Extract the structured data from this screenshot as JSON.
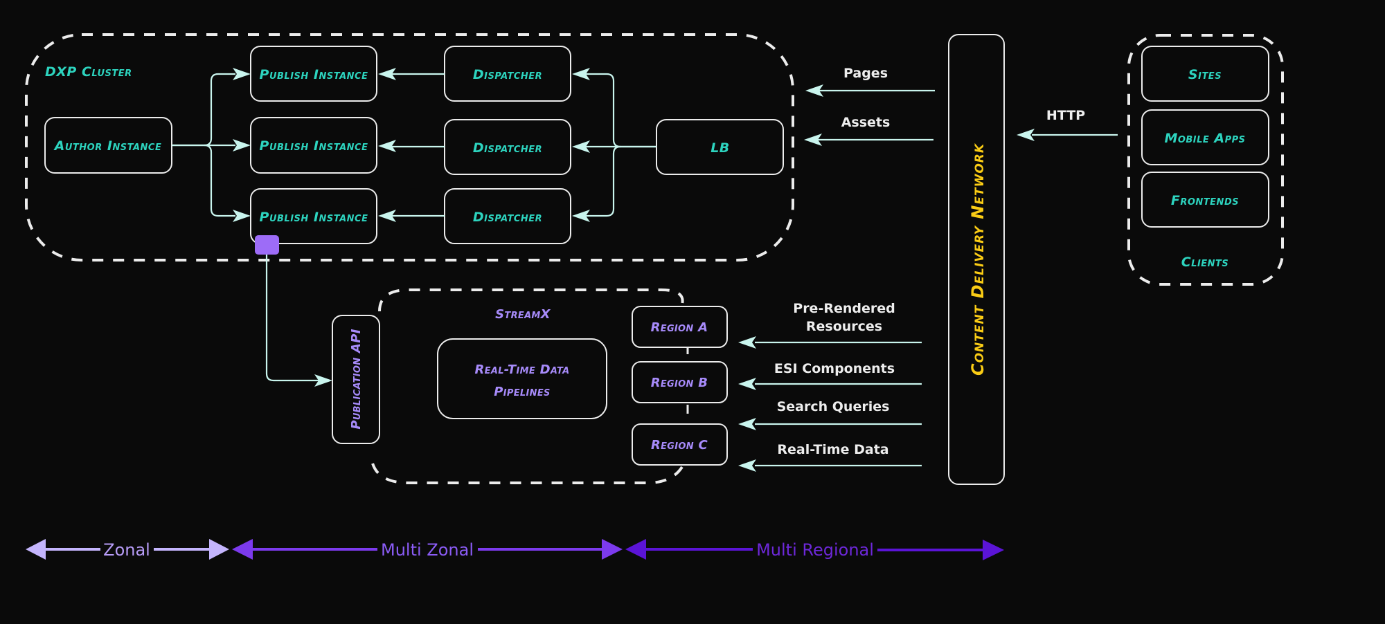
{
  "colors": {
    "background": "#0a0a0a",
    "box_stroke": "#ececec",
    "connector": "#c9f5ee",
    "teal_text": "#2dd4bf",
    "purple_text": "#a78bfa",
    "cdn_text": "#facc15",
    "flow_text": "#eeeeee",
    "publication_handle": "#9d6cf7",
    "zonal": "#c4b5fd",
    "multi_zonal": "#7c3aed",
    "multi_regional": "#5b14d6"
  },
  "dxp_cluster": {
    "title": "DXP Cluster",
    "author": "Author Instance",
    "publish_instances": [
      "Publish Instance",
      "Publish Instance",
      "Publish Instance"
    ],
    "dispatchers": [
      "Dispatcher",
      "Dispatcher",
      "Dispatcher"
    ],
    "load_balancer": "LB"
  },
  "cdn": {
    "label": "Content Delivery Network"
  },
  "cdn_to_dxp_flows": [
    "Pages",
    "Assets"
  ],
  "client_to_cdn_flow": "HTTP",
  "clients": {
    "title": "Clients",
    "items": [
      "Sites",
      "Mobile Apps",
      "Frontends"
    ]
  },
  "streamx": {
    "title": "StreamX",
    "publication_api": "Publication API",
    "pipelines": [
      "Real-Time Data",
      "Pipelines"
    ],
    "regions": [
      "Region A",
      "Region B",
      "Region C"
    ]
  },
  "cdn_to_streamx_flows": [
    [
      "Pre-Rendered",
      "Resources"
    ],
    [
      "ESI Components"
    ],
    [
      "Search Queries"
    ],
    [
      "Real-Time Data"
    ]
  ],
  "scopes": [
    {
      "label": "Zonal"
    },
    {
      "label": "Multi Zonal"
    },
    {
      "label": "Multi Regional"
    }
  ]
}
